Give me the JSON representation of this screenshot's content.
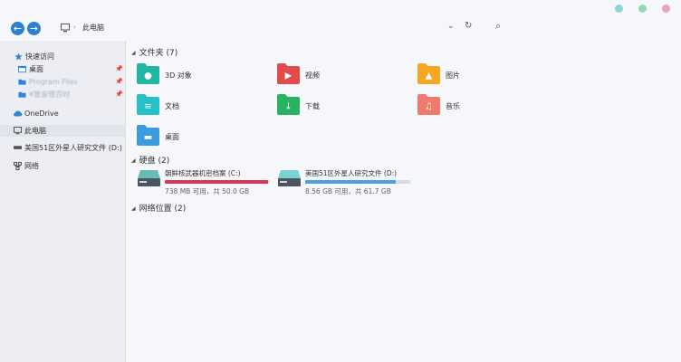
{
  "titlebar": {
    "dots": [
      "#8ed4d0",
      "#9ad8b0",
      "#f0a0b8"
    ]
  },
  "address": {
    "back_glyph": "←",
    "forward_glyph": "→",
    "crumb_sep": "›",
    "crumb": "此电脑",
    "dropdown_glyph": "⌄",
    "refresh_glyph": "↻",
    "search_glyph": "⌕"
  },
  "sidebar": {
    "quick_access": "快速访问",
    "quick_items": [
      "桌面",
      "Program Files",
      "¥管家理百时"
    ],
    "pin_glyph": "📌",
    "onedrive": "OneDrive",
    "this_pc": "此电脑",
    "drive_d": "美国51区外星人研究文件 (D:)",
    "network": "网络"
  },
  "sections": {
    "folders": "文件夹 (7)",
    "drives": "硬盘 (2)",
    "network": "网络位置 (2)",
    "caret": "◢"
  },
  "folders": [
    {
      "label": "3D 对象",
      "color": "#1fb7a2",
      "symbol": "●"
    },
    {
      "label": "视频",
      "color": "#e14b4b",
      "symbol": "▶"
    },
    {
      "label": "图片",
      "color": "#f5a623",
      "symbol": "▲"
    },
    {
      "label": "文档",
      "color": "#27c0c7",
      "symbol": "≡"
    },
    {
      "label": "下载",
      "color": "#27b35f",
      "symbol": "↓"
    },
    {
      "label": "音乐",
      "color": "#f07a6e",
      "symbol": "♫"
    },
    {
      "label": "桌面",
      "color": "#3a9be0",
      "symbol": "▬"
    }
  ],
  "drives": [
    {
      "name": "朝鲜核武器机密档案 (C:)",
      "info": "738 MB 可用，共 50.0 GB",
      "used_fraction": 0.985,
      "bar_color": "#d9375a",
      "icon_color": "#3aa89e"
    },
    {
      "name": "美国51区外星人研究文件 (D:)",
      "info": "8.56 GB 可用，共 61.7 GB",
      "used_fraction": 0.86,
      "bar_color": "#4aa0e6",
      "icon_color": "#4fc6c4"
    }
  ]
}
